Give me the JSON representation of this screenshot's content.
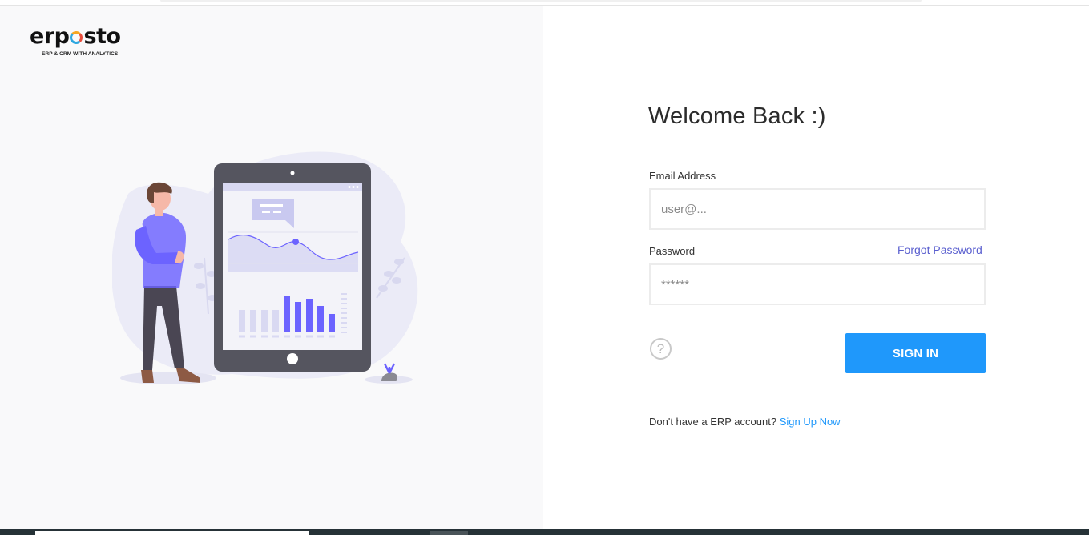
{
  "brand": {
    "logo_prefix": "erp",
    "logo_suffix": "sto",
    "tagline": "ERP & CRM WITH ANALYTICS",
    "accent_colors": [
      "#2ea7e0",
      "#f5a623",
      "#e94e3d"
    ]
  },
  "illustration": {
    "icons": [
      "person-figure",
      "tablet-device",
      "line-chart",
      "bar-chart",
      "chat-bubble",
      "plant"
    ],
    "accent_color": "#6c63ff"
  },
  "login": {
    "title": "Welcome Back :)",
    "email_label": "Email Address",
    "email_placeholder": "user@...",
    "email_value": "",
    "password_label": "Password",
    "password_placeholder": "******",
    "password_value": "",
    "forgot_label": "Forgot Password",
    "help_icon": "question-circle-icon",
    "help_glyph": "?",
    "signin_label": "SIGN IN",
    "signup_prompt": "Don't have a ERP account?",
    "signup_link": "Sign Up Now"
  },
  "colors": {
    "primary": "#1f98fb",
    "link_purple": "#5a5fcf",
    "left_panel_bg": "#f9f9fa"
  }
}
